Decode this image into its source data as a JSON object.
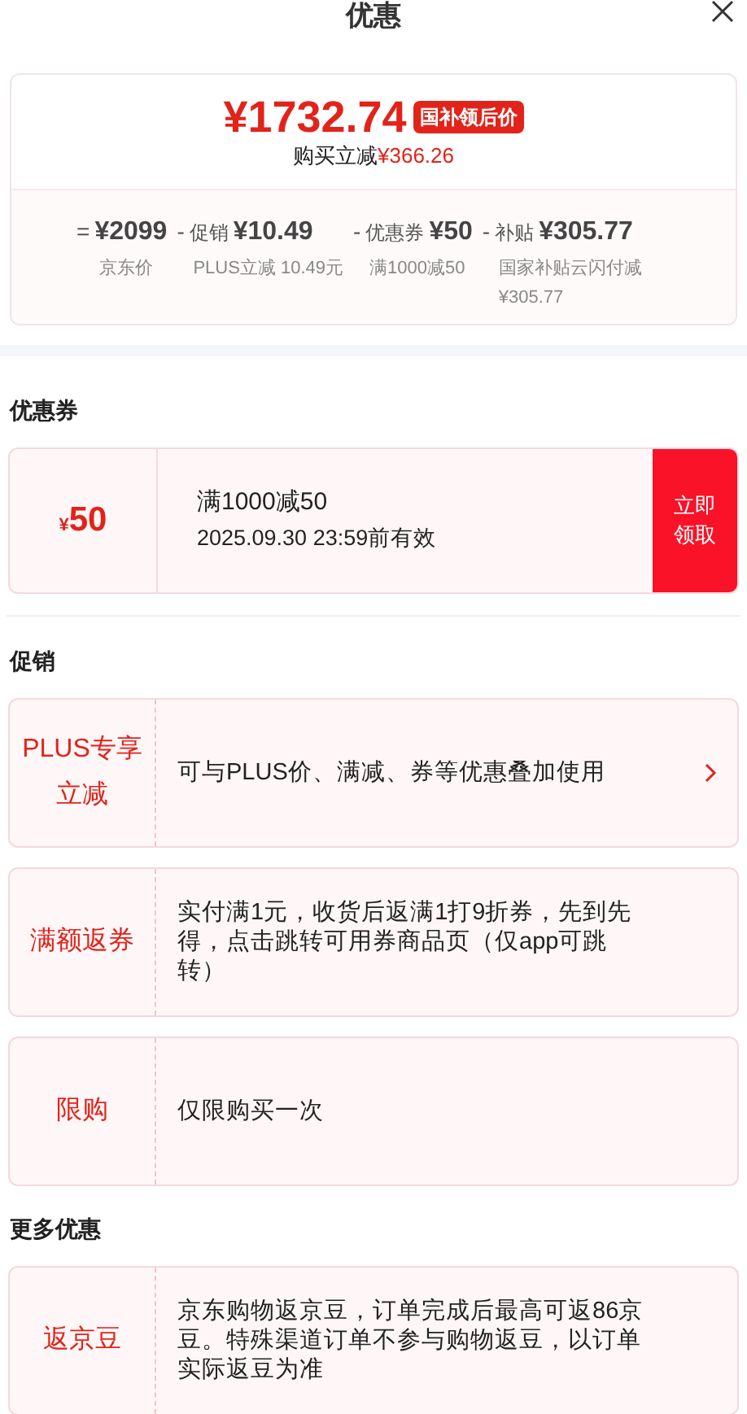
{
  "title": "优惠",
  "summary": {
    "price": "¥1732.74",
    "price_tag": "国补领后价",
    "saving_label": "购买立减",
    "saving_amount": "¥366.26",
    "breakdown": [
      {
        "operator": "=",
        "amount": "¥2099",
        "note": "京东价"
      },
      {
        "operator": "-",
        "label": "促销",
        "amount": "¥10.49",
        "note": "PLUS立减 10.49元"
      },
      {
        "operator": "-",
        "label": "优惠券",
        "amount": "¥50",
        "note": "满1000减50"
      },
      {
        "operator": "-",
        "label": "补贴",
        "amount": "¥305.77",
        "note": "国家补贴云闪付减¥305.77"
      }
    ]
  },
  "coupons_section": {
    "heading": "优惠券",
    "coupons": [
      {
        "currency": "¥",
        "value": "50",
        "condition": "满1000减50",
        "validity": "2025.09.30 23:59前有效",
        "action": "立即领取"
      }
    ]
  },
  "promotions_section": {
    "heading": "促销",
    "items": [
      {
        "tag": "PLUS专享立减",
        "text": "可与PLUS价、满减、券等优惠叠加使用",
        "has_arrow": true
      },
      {
        "tag": "满额返券",
        "text": "实付满1元，收货后返满1打9折券，先到先得，点击跳转可用券商品页（仅app可跳转）",
        "has_arrow": false
      },
      {
        "tag": "限购",
        "text": "仅限购买一次",
        "has_arrow": false
      }
    ]
  },
  "more_section": {
    "heading": "更多优惠",
    "items": [
      {
        "tag": "返京豆",
        "text": "京东购物返京豆，订单完成后最高可返86京豆。特殊渠道订单不参与购物返豆，以订单实际返豆为准",
        "has_arrow": false
      }
    ]
  }
}
